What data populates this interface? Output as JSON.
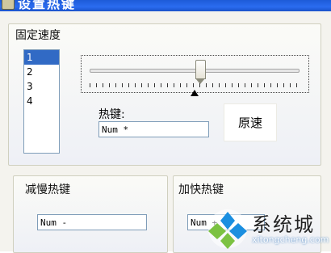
{
  "window": {
    "title": "设置热键"
  },
  "speed_panel": {
    "title": "固定速度",
    "list_items": [
      "1",
      "2",
      "3",
      "4"
    ],
    "selected_index": 0,
    "slider_value_fraction": 0.53,
    "hotkey_label": "热键:",
    "hotkey_value": "Num *",
    "reset_button": "原速"
  },
  "slow_panel": {
    "title": "减慢热键",
    "hotkey_value": "Num -"
  },
  "fast_panel": {
    "title": "加快热键",
    "hotkey_value": "Num +"
  },
  "watermark": {
    "text_cn": "系统城",
    "text_en": "xitongcheng.com"
  },
  "colors": {
    "titlebar": "#2a6cf0",
    "selection": "#316ac5",
    "panel_border": "#d0d0bf",
    "field_border": "#7f9db9",
    "logo_blue": "#1b8fe0",
    "logo_green": "#7cc242"
  }
}
